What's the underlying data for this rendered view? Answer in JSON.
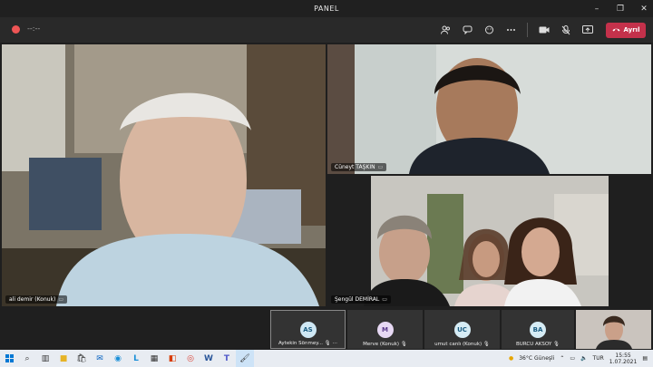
{
  "window": {
    "title": "PANEL",
    "controls": [
      "–",
      "❐",
      "✕"
    ]
  },
  "meeting": {
    "timer": "--:--"
  },
  "toolbar": {
    "icons": [
      "people-icon",
      "chat-icon",
      "reactions-icon",
      "more-icon",
      "camera-icon",
      "mic-off-icon",
      "share-icon"
    ],
    "leave_label": "Ayrıl"
  },
  "participants": {
    "main1": {
      "name": "ali demir (Konuk)"
    },
    "main2": {
      "name": "Cüneyt TAŞKIN"
    },
    "main3": {
      "name": "Şengül DEMİRAL"
    }
  },
  "strip": [
    {
      "initials": "AS",
      "name": "Aytekin Sönmey...",
      "color": "#cfe8f5",
      "text": "#1a5b80"
    },
    {
      "initials": "M",
      "name": "Merve (Konuk)",
      "color": "#e6d8f3",
      "text": "#5a3a8a"
    },
    {
      "initials": "UC",
      "name": "umut canlı (Konuk)",
      "color": "#d6ecf5",
      "text": "#1a5b80"
    },
    {
      "initials": "BA",
      "name": "BURCU AKSOY",
      "color": "#d6ecf5",
      "text": "#1a5b80"
    }
  ],
  "taskbar": {
    "weather": "36°C  Güneşli",
    "lang": "TUR",
    "time": "15:55",
    "date": "1.07.2021"
  }
}
